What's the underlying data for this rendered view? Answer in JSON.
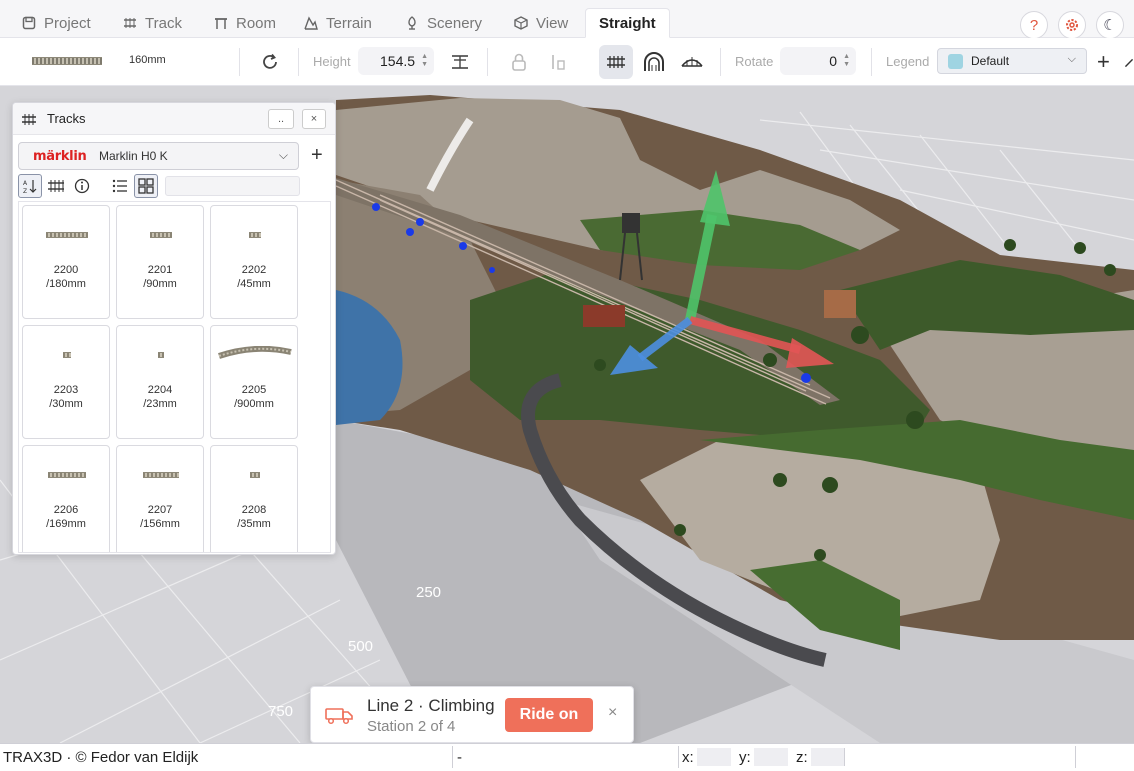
{
  "tabs": [
    {
      "label": "Project",
      "icon": "save-icon"
    },
    {
      "label": "Track",
      "icon": "track-icon"
    },
    {
      "label": "Room",
      "icon": "table-icon"
    },
    {
      "label": "Terrain",
      "icon": "mountain-icon"
    },
    {
      "label": "Scenery",
      "icon": "tree-icon"
    },
    {
      "label": "View",
      "icon": "cube-icon"
    },
    {
      "label": "Straight",
      "icon": "",
      "active": true
    }
  ],
  "toolbar": {
    "track_length": "160mm",
    "height_label": "Height",
    "height_value": "154.5",
    "rotate_label": "Rotate",
    "rotate_value": "0",
    "legend_label": "Legend",
    "legend_value": "Default",
    "legend_color": "#9fd4e2"
  },
  "viewport": {
    "grid_labels": [
      "250",
      "500",
      "750"
    ]
  },
  "tracks_panel": {
    "title": "Tracks",
    "more_label": "..",
    "close_label": "×",
    "brand_logo": "märklin",
    "brand_value": "Marklin H0 K",
    "search_placeholder": "",
    "tiles": [
      {
        "code": "2200",
        "len": "/180mm"
      },
      {
        "code": "2201",
        "len": "/90mm"
      },
      {
        "code": "2202",
        "len": "/45mm"
      },
      {
        "code": "2203",
        "len": "/30mm"
      },
      {
        "code": "2204",
        "len": "/23mm"
      },
      {
        "code": "2205",
        "len": "/900mm"
      },
      {
        "code": "2206",
        "len": "/169mm"
      },
      {
        "code": "2207",
        "len": "/156mm"
      },
      {
        "code": "2208",
        "len": "/35mm"
      }
    ]
  },
  "ride_card": {
    "title": "Line 2 · Climbing",
    "subtitle": "Station 2 of 4",
    "button": "Ride on",
    "close": "×",
    "accent": "#ef705a"
  },
  "status": {
    "credit": "TRAX3D · © Fedor van Eldijk",
    "selection": "-",
    "x_label": "x:",
    "y_label": "y:",
    "z_label": "z:"
  },
  "colors": {
    "tab_bg": "#f6f6f8",
    "brand_red": "#dd2222",
    "axis_green": "#4fc46a",
    "axis_red": "#e25555",
    "axis_blue": "#4d8fe0"
  }
}
